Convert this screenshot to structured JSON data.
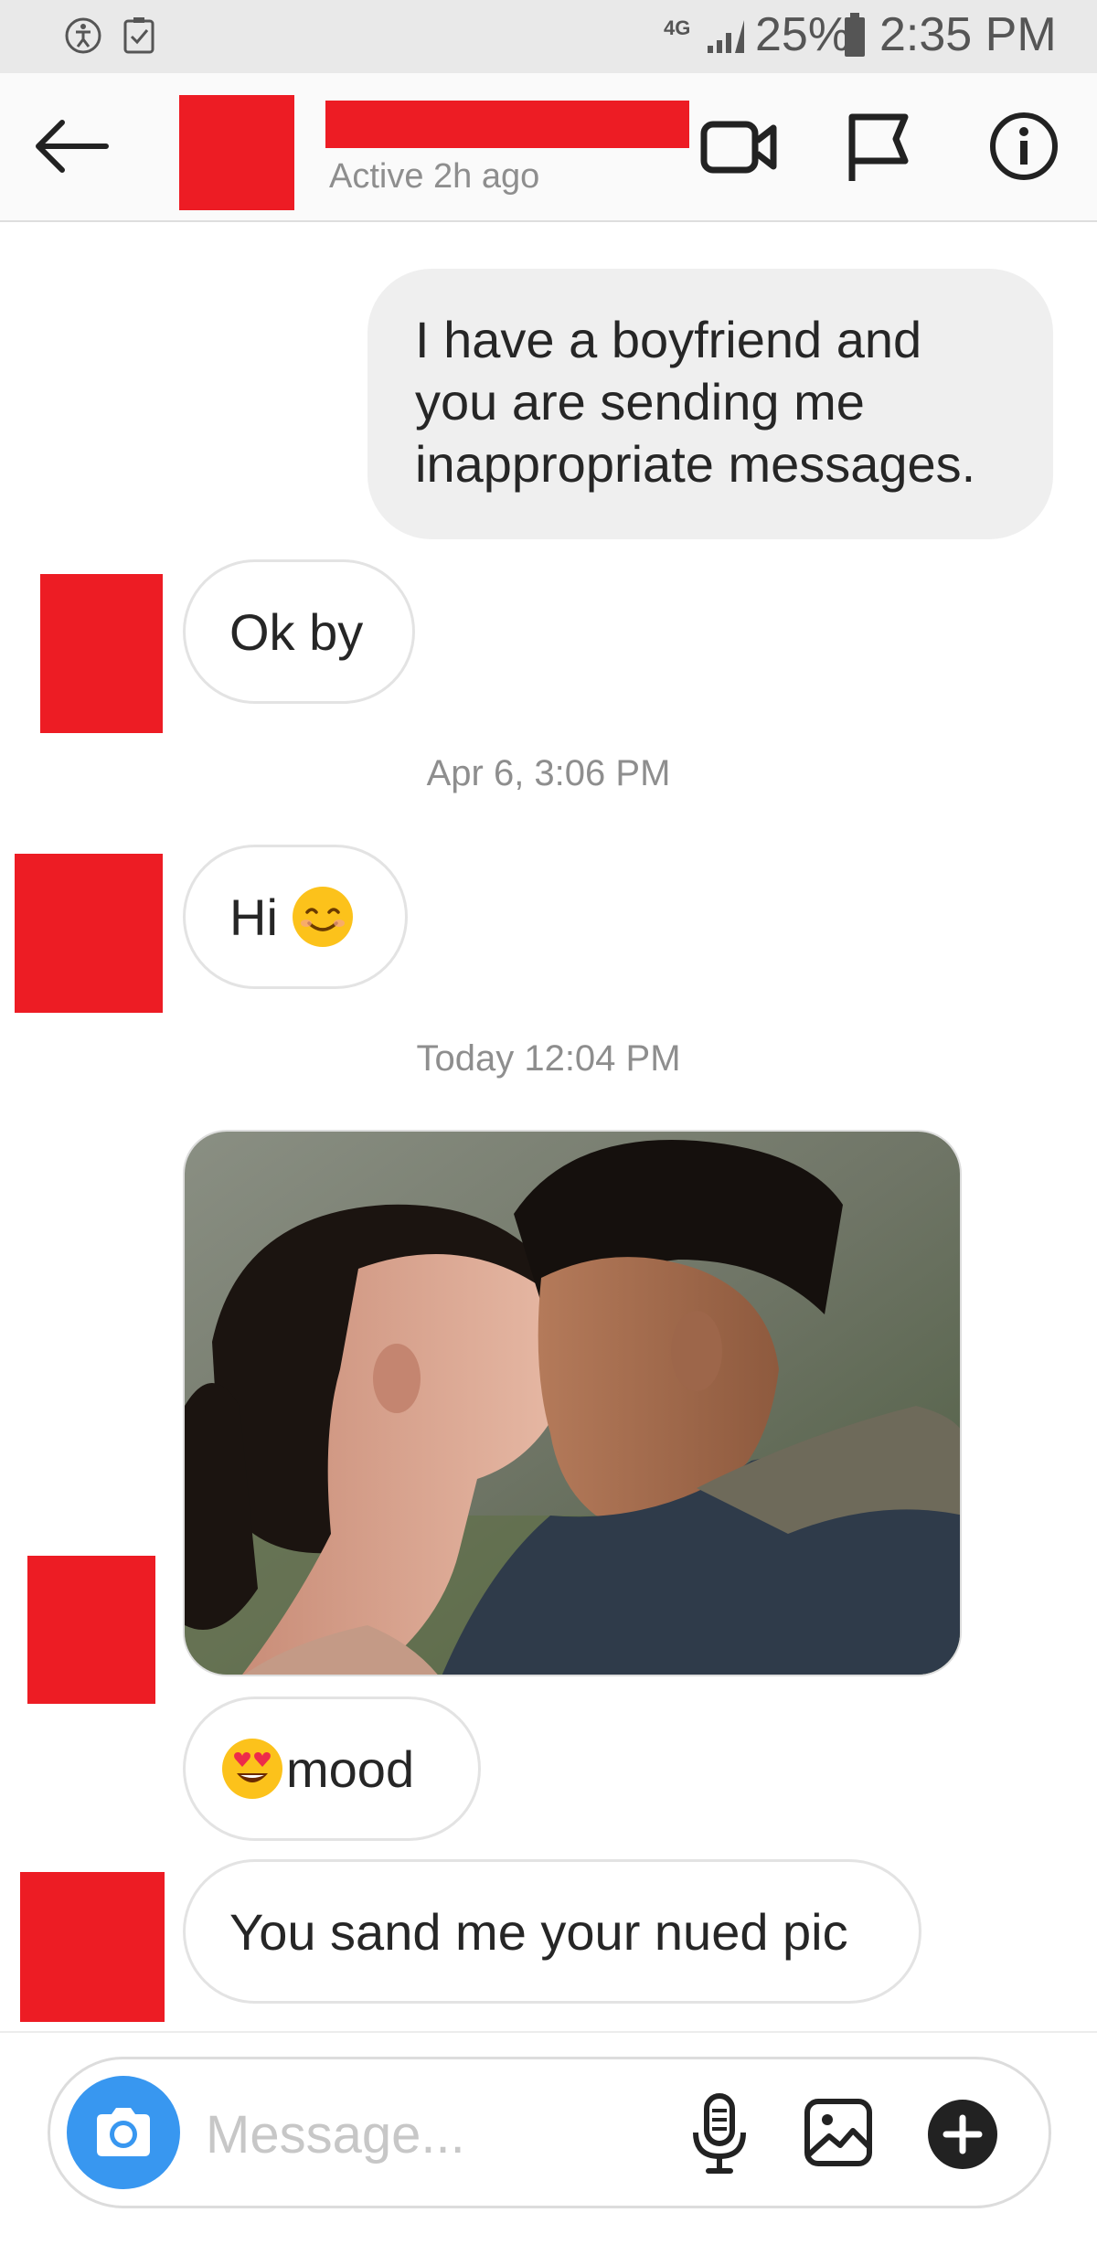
{
  "status_bar": {
    "network": "4G",
    "battery": "25%",
    "time": "2:35 PM"
  },
  "header": {
    "active_status": "Active 2h ago",
    "icons": [
      "back-arrow-icon",
      "video-call-icon",
      "flag-icon",
      "info-icon"
    ]
  },
  "messages": [
    {
      "side": "sent",
      "text": "I have a boyfriend and you are sending me inappropriate messages."
    },
    {
      "side": "received",
      "text": "Ok by"
    },
    {
      "timestamp": "Apr 6, 3:06 PM"
    },
    {
      "side": "received",
      "text": "Hi",
      "emoji": "smiling-face-emoji"
    },
    {
      "timestamp": "Today 12:04 PM"
    },
    {
      "side": "received",
      "type": "image",
      "description_icon": "photo"
    },
    {
      "side": "received",
      "text": "mood",
      "emoji": "heart-eyes-emoji"
    },
    {
      "side": "received",
      "text": "You sand me your nued pic"
    }
  ],
  "sent_1": {
    "line1": "I have a boyfriend and",
    "line2": "you are sending me",
    "line3": "inappropriate messages."
  },
  "received_1": "Ok by",
  "timestamp_1": "Apr 6, 3:06 PM",
  "received_2": "Hi",
  "timestamp_2": "Today 12:04 PM",
  "received_4": "mood",
  "received_5": "You sand me your nued pic",
  "composer": {
    "placeholder": "Message..."
  },
  "colors": {
    "redaction": "#ed1c24",
    "accent": "#3897f0",
    "sent_bubble": "#efefef"
  }
}
